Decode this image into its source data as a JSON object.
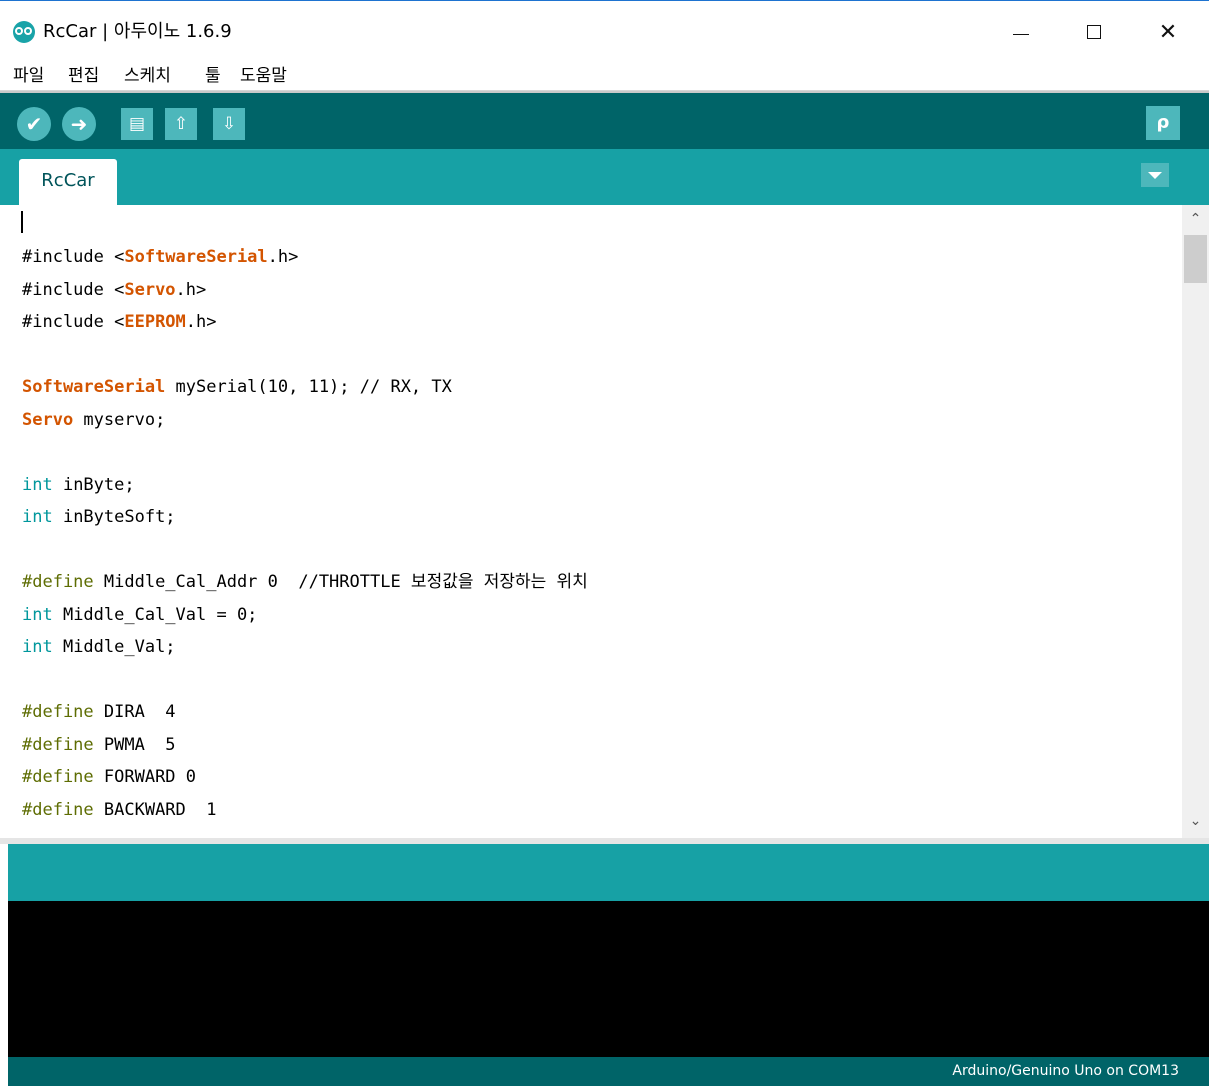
{
  "window": {
    "title": "RcCar | 아두이노 1.6.9",
    "minimize_glyph": "—",
    "close_glyph": "✕"
  },
  "menu": [
    "파일",
    "편집",
    "스케치",
    "툴",
    "도움말"
  ],
  "toolbar": {
    "verify_icon": "✔",
    "upload_icon": "➜",
    "new_icon": "▤",
    "open_icon": "⇧",
    "save_icon": "⇩",
    "serial_monitor_icon": "ρ"
  },
  "tabs": [
    {
      "label": "RcCar",
      "active": true
    }
  ],
  "code_lines": [
    [
      {
        "t": "#include <",
        "c": ""
      },
      {
        "t": "SoftwareSerial",
        "c": "kw1"
      },
      {
        "t": ".h>",
        "c": ""
      }
    ],
    [
      {
        "t": "#include <",
        "c": ""
      },
      {
        "t": "Servo",
        "c": "kw1"
      },
      {
        "t": ".h>",
        "c": ""
      }
    ],
    [
      {
        "t": "#include <",
        "c": ""
      },
      {
        "t": "EEPROM",
        "c": "kw1"
      },
      {
        "t": ".h>",
        "c": ""
      }
    ],
    [],
    [
      {
        "t": "SoftwareSerial",
        "c": "kw1"
      },
      {
        "t": " mySerial(10, 11); // RX, TX",
        "c": ""
      }
    ],
    [
      {
        "t": "Servo",
        "c": "kw1"
      },
      {
        "t": " myservo;",
        "c": ""
      }
    ],
    [],
    [
      {
        "t": "int",
        "c": "kw2"
      },
      {
        "t": " inByte;",
        "c": ""
      }
    ],
    [
      {
        "t": "int",
        "c": "kw2"
      },
      {
        "t": " inByteSoft;",
        "c": ""
      }
    ],
    [],
    [
      {
        "t": "#define",
        "c": "pp"
      },
      {
        "t": " Middle_Cal_Addr 0  //THROTTLE 보정값을 저장하는 위치",
        "c": ""
      }
    ],
    [
      {
        "t": "int",
        "c": "kw2"
      },
      {
        "t": " Middle_Cal_Val = 0;",
        "c": ""
      }
    ],
    [
      {
        "t": "int",
        "c": "kw2"
      },
      {
        "t": " Middle_Val;",
        "c": ""
      }
    ],
    [],
    [
      {
        "t": "#define",
        "c": "pp"
      },
      {
        "t": " DIRA  4",
        "c": ""
      }
    ],
    [
      {
        "t": "#define",
        "c": "pp"
      },
      {
        "t": " PWMA  5",
        "c": ""
      }
    ],
    [
      {
        "t": "#define",
        "c": "pp"
      },
      {
        "t": " FORWARD 0",
        "c": ""
      }
    ],
    [
      {
        "t": "#define",
        "c": "pp"
      },
      {
        "t": " BACKWARD  1",
        "c": ""
      }
    ]
  ],
  "scrollbar": {
    "up_glyph": "⌃",
    "down_glyph": "⌄"
  },
  "status": {
    "board": "Arduino/Genuino Uno on COM13"
  },
  "colors": {
    "teal_dark": "#006468",
    "teal": "#17a1a5",
    "button": "#4db7bb",
    "keyword_class": "#d35400",
    "keyword_type": "#00979c",
    "preprocessor": "#5e6d03"
  }
}
